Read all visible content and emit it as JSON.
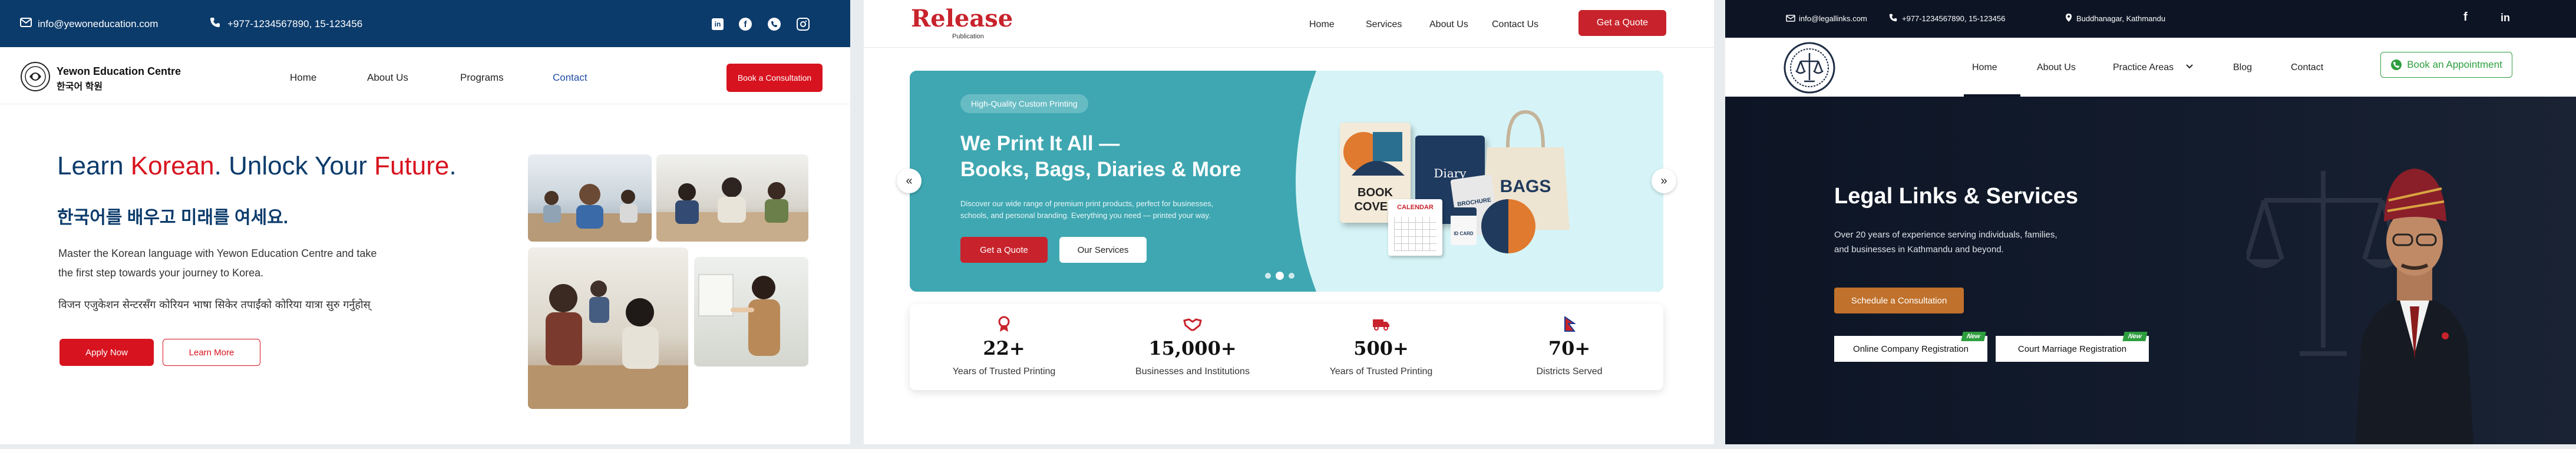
{
  "panel1": {
    "topbar": {
      "email": "info@yewoneducation.com",
      "phone": "+977-1234567890,  15-123456",
      "social_icons": [
        "linkedin-icon",
        "facebook-icon",
        "whatsapp-icon",
        "instagram-icon"
      ]
    },
    "brand": {
      "name": "Yewon Education Centre",
      "korean": "한국어 학원"
    },
    "nav": {
      "home": "Home",
      "about": "About Us",
      "programs": "Programs",
      "contact": "Contact"
    },
    "cta": "Book a Consultation",
    "hero": {
      "title_learn": "Learn ",
      "title_korean": "Korean",
      "title_unlock": ". Unlock Your ",
      "title_future": "Future",
      "title_end": ".",
      "subtitle": "한국어를 배우고 미래를 여세요.",
      "desc_line1": "Master the Korean language with Yewon Education Centre and take",
      "desc_line2": "the first step towards your journey to Korea.",
      "nepali": "विजन एजुकेशन सेन्टरसँग कोरियन भाषा सिकेर तपाईंको कोरिया यात्रा सुरु गर्नुहोस्",
      "apply": "Apply Now",
      "learn_more": "Learn More"
    },
    "colors": {
      "navy": "#0b3b6b",
      "red": "#d7131f",
      "blue": "#1f4ea3"
    }
  },
  "panel2": {
    "logo": {
      "name": "Release",
      "sub": "Publication"
    },
    "nav": {
      "home": "Home",
      "services": "Services",
      "about": "About Us",
      "contact": "Contact Us"
    },
    "cta": "Get a Quote",
    "hero": {
      "badge": "High-Quality Custom Printing",
      "title1": "We Print It All —",
      "title2": "Books, Bags, Diaries & More",
      "desc1": "Discover our wide range of premium print products, perfect for businesses,",
      "desc2": "schools, and personal branding. Everything you need — printed your way.",
      "btn_quote": "Get a Quote",
      "btn_services": "Our Services",
      "product_labels": {
        "book1": "BOOK",
        "book2": "COVER",
        "diary": "Diary",
        "brochure": "BROCHURE",
        "calendar": "CALENDAR",
        "bags": "BAGS",
        "idcard": "ID CARD"
      },
      "prev": "«",
      "next": "»"
    },
    "stats": [
      {
        "icon": "award-icon",
        "value": "22+",
        "label": "Years of Trusted Printing"
      },
      {
        "icon": "handshake-icon",
        "value": "15,000+",
        "label": "Businesses and Institutions"
      },
      {
        "icon": "truck-icon",
        "value": "500+",
        "label": "Years of Trusted Printing"
      },
      {
        "icon": "nepal-flag-icon",
        "value": "70+",
        "label": "Districts Served"
      }
    ],
    "colors": {
      "red": "#c8232c",
      "teal": "#3fa7b1"
    }
  },
  "panel3": {
    "topbar": {
      "email": "info@legallinks.com",
      "phone": "+977-1234567890,  15-123456",
      "location": "Buddhanagar, Kathmandu",
      "social_icons": [
        "facebook-icon",
        "linkedin-icon"
      ]
    },
    "nav": {
      "home": "Home",
      "about": "About Us",
      "practice": "Practice Areas",
      "blog": "Blog",
      "contact": "Contact"
    },
    "cta": "Book an Appointment",
    "hero": {
      "title": "Legal Links & Services",
      "desc1": "Over 20 years of experience serving individuals, families,",
      "desc2": "and businesses in Kathmandu and beyond.",
      "schedule": "Schedule a Consultation",
      "service1": "Online Company Registration",
      "service2": "Court Marriage Registration",
      "new_badge": "New"
    },
    "colors": {
      "bg": "#0d1525",
      "orange": "#c0712b",
      "green": "#2e9e3e"
    }
  }
}
